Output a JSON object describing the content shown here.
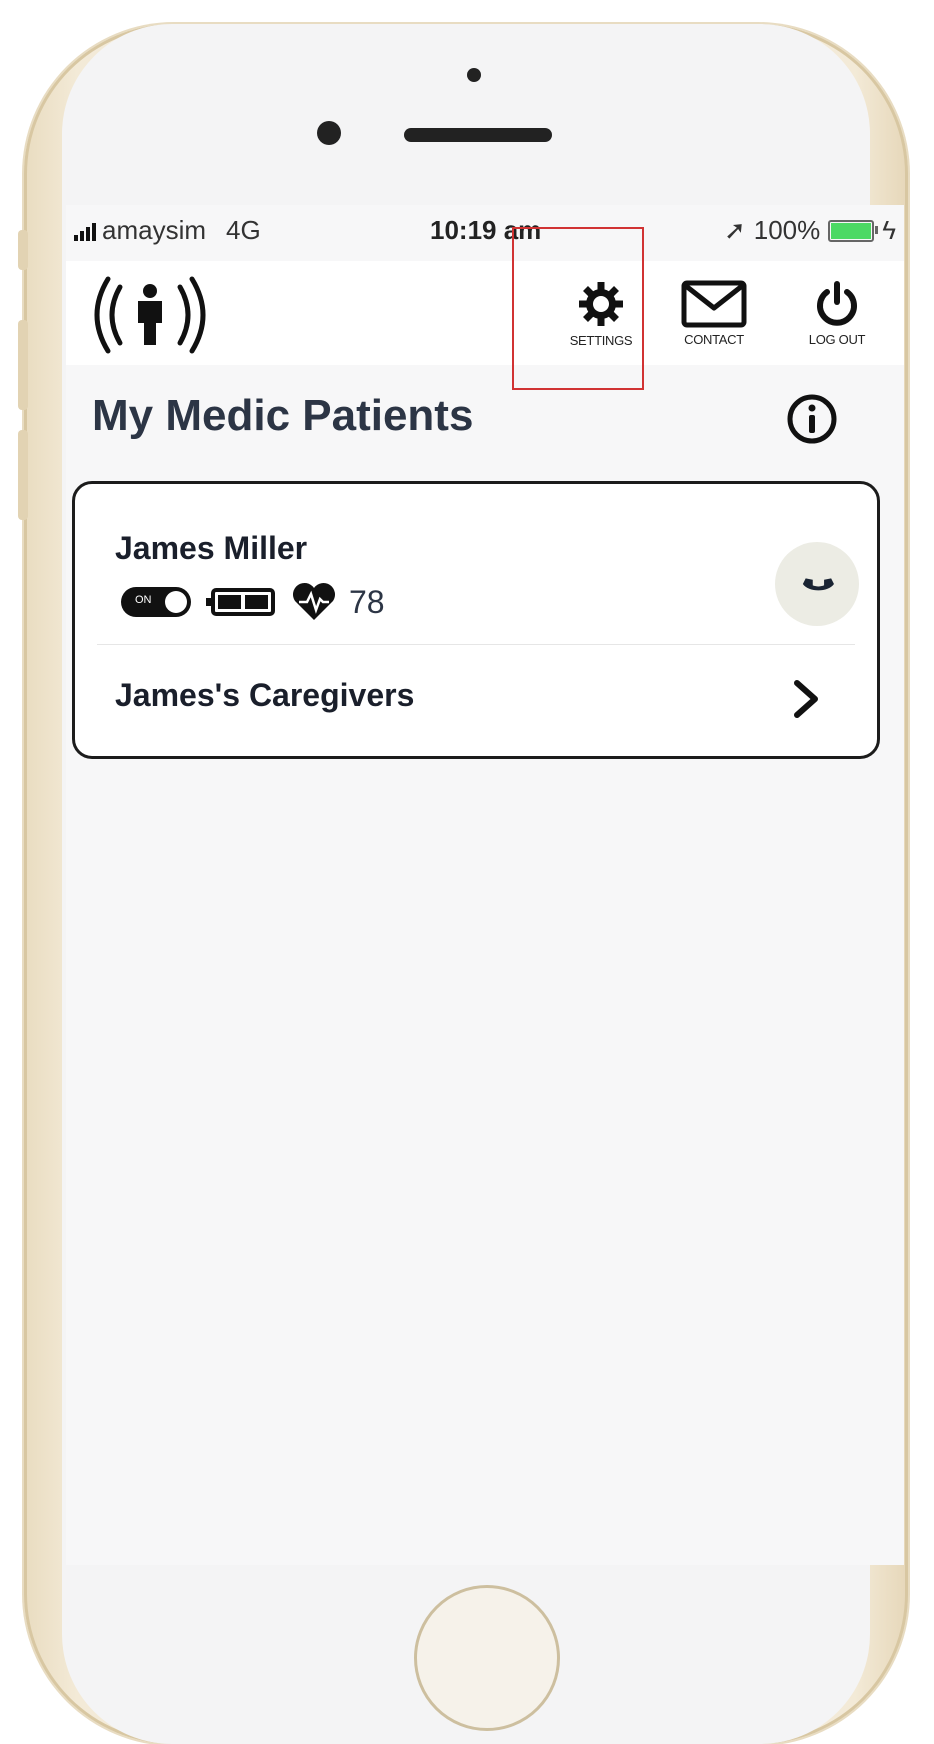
{
  "status_bar": {
    "carrier": "amaysim",
    "network": "4G",
    "time": "10:19 am",
    "battery": "100%",
    "battery_level": 1.0
  },
  "header": {
    "logo_icon": "person-broadcast-icon",
    "buttons": [
      {
        "label": "SETTINGS",
        "icon": "gear-icon"
      },
      {
        "label": "CONTACT",
        "icon": "envelope-icon"
      },
      {
        "label": "LOG OUT",
        "icon": "power-icon"
      }
    ],
    "highlighted": "SETTINGS",
    "highlight_color": "#d13333"
  },
  "main": {
    "title": "My Medic Patients",
    "info_icon": "info-icon",
    "patients": [
      {
        "name": "James Miller",
        "device_toggle": "ON",
        "device_battery_icon": "battery-icon",
        "heart_icon": "heart-pulse-icon",
        "heart_rate": "78",
        "call_icon": "phone-icon",
        "caregivers_label": "James's Caregivers",
        "caregivers_icon": "chevron-right-icon"
      }
    ]
  },
  "colors": {
    "title_text": "#2c3545",
    "phone_frame": "#f3ead7",
    "screen_bg": "#f7f7f8",
    "call_button_bg": "#ecece4",
    "battery_green": "#4cd964"
  }
}
